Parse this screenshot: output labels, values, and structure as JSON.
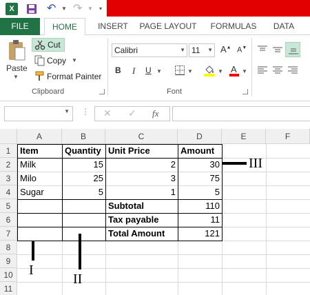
{
  "qat": {
    "app_icon_text": "X",
    "icons": [
      "excel-icon",
      "save-icon",
      "undo-icon",
      "redo-icon",
      "customize-icon"
    ]
  },
  "tabs": [
    "FILE",
    "HOME",
    "INSERT",
    "PAGE LAYOUT",
    "FORMULAS",
    "DATA"
  ],
  "clipboard": {
    "paste": "Paste",
    "cut": "Cut",
    "copy": "Copy",
    "format_painter": "Format Painter",
    "group_label": "Clipboard"
  },
  "font": {
    "family": "Calibri",
    "size": "11",
    "grow": "A",
    "shrink": "A",
    "bold": "B",
    "italic": "I",
    "underline": "U",
    "group_label": "Font",
    "font_color_letter": "A"
  },
  "formula_bar": {
    "name_box": "",
    "fx": "fx",
    "formula": ""
  },
  "columns": [
    "A",
    "B",
    "C",
    "D",
    "E",
    "F"
  ],
  "rows": [
    "1",
    "2",
    "3",
    "4",
    "5",
    "6",
    "7",
    "8",
    "9",
    "10",
    "11"
  ],
  "table": {
    "header": [
      "Item",
      "Quantity",
      "Unit Price",
      "Amount"
    ],
    "items": [
      {
        "item": "Milk",
        "quantity": "15",
        "unit_price": "2",
        "amount": "30"
      },
      {
        "item": "Milo",
        "quantity": "25",
        "unit_price": "3",
        "amount": "75"
      },
      {
        "item": "Sugar",
        "quantity": "5",
        "unit_price": "1",
        "amount": "5"
      }
    ],
    "summary": [
      {
        "label": "Subtotal",
        "value": "110"
      },
      {
        "label": "Tax payable",
        "value": "11"
      },
      {
        "label": "Total Amount",
        "value": "121"
      }
    ]
  },
  "annotations": [
    "I",
    "II",
    "III"
  ],
  "colors": {
    "excel_green": "#217346",
    "title_band": "#e30000",
    "cut_highlight": "#c9e7d6",
    "fill_yellow": "#ffff00",
    "font_red": "#ff0000"
  }
}
